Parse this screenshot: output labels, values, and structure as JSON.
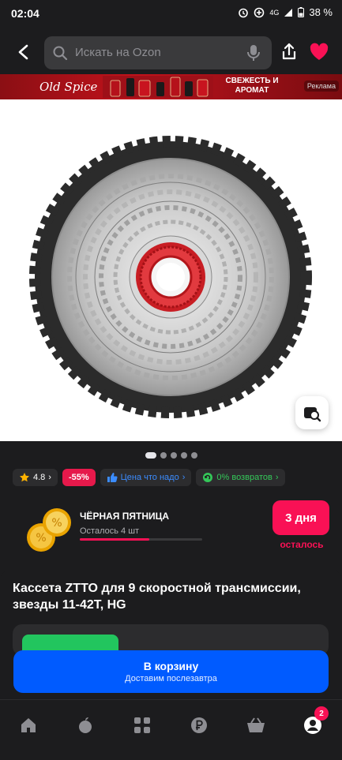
{
  "status_bar": {
    "time": "02:04",
    "network": "4G",
    "battery": "38 %"
  },
  "search": {
    "placeholder": "Искать на Ozon"
  },
  "ad": {
    "brand": "Old Spice",
    "slogan": "СВЕЖЕСТЬ И АРОМАТ",
    "tag": "Реклама"
  },
  "gallery": {
    "image_count": 5,
    "active_index": 0
  },
  "chips": {
    "rating": "4.8",
    "discount": "-55%",
    "price_hint": "Цена что надо",
    "returns": "0% возвратов"
  },
  "promo": {
    "title": "ЧЁРНАЯ ПЯТНИЦА",
    "remaining": "Осталось 4 шт",
    "progress": 0.57,
    "days": "3 дня",
    "days_label": "осталось"
  },
  "product": {
    "title": "Кассета ZTTO для 9 скоростной трансмиссии, звезды 11-42T, HG"
  },
  "cart": {
    "label": "В корзину",
    "delivery": "Доставим послезавтра"
  },
  "nav": {
    "profile_badge": "2"
  },
  "colors": {
    "accent": "#005bff",
    "sale": "#f91155",
    "background": "#1c1c1e"
  }
}
